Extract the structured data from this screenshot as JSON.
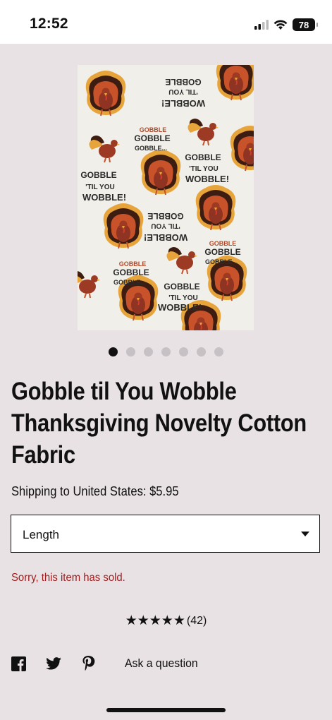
{
  "status_bar": {
    "time": "12:52",
    "battery": "78"
  },
  "carousel": {
    "total": 7,
    "active_index": 0
  },
  "fabric_text": {
    "line1": "GOBBLE",
    "line2": "'TIL YOU",
    "line3": "WOBBLE!",
    "small1": "GOBBLE",
    "small2": "GOBBLE",
    "small3": "GOBBLE..."
  },
  "product": {
    "title": "Gobble til You Wobble Thanksgiving Novelty Cotton Fabric",
    "shipping": "Shipping to United States: $5.95",
    "length_label": "Length",
    "sold_message": "Sorry, this item has sold.",
    "stars": "★★★★★",
    "review_count": "(42)"
  },
  "share": {
    "ask_label": "Ask a question"
  },
  "colors": {
    "background": "#e8e2e5",
    "sold_red": "#a01d1d",
    "text": "#111111"
  }
}
